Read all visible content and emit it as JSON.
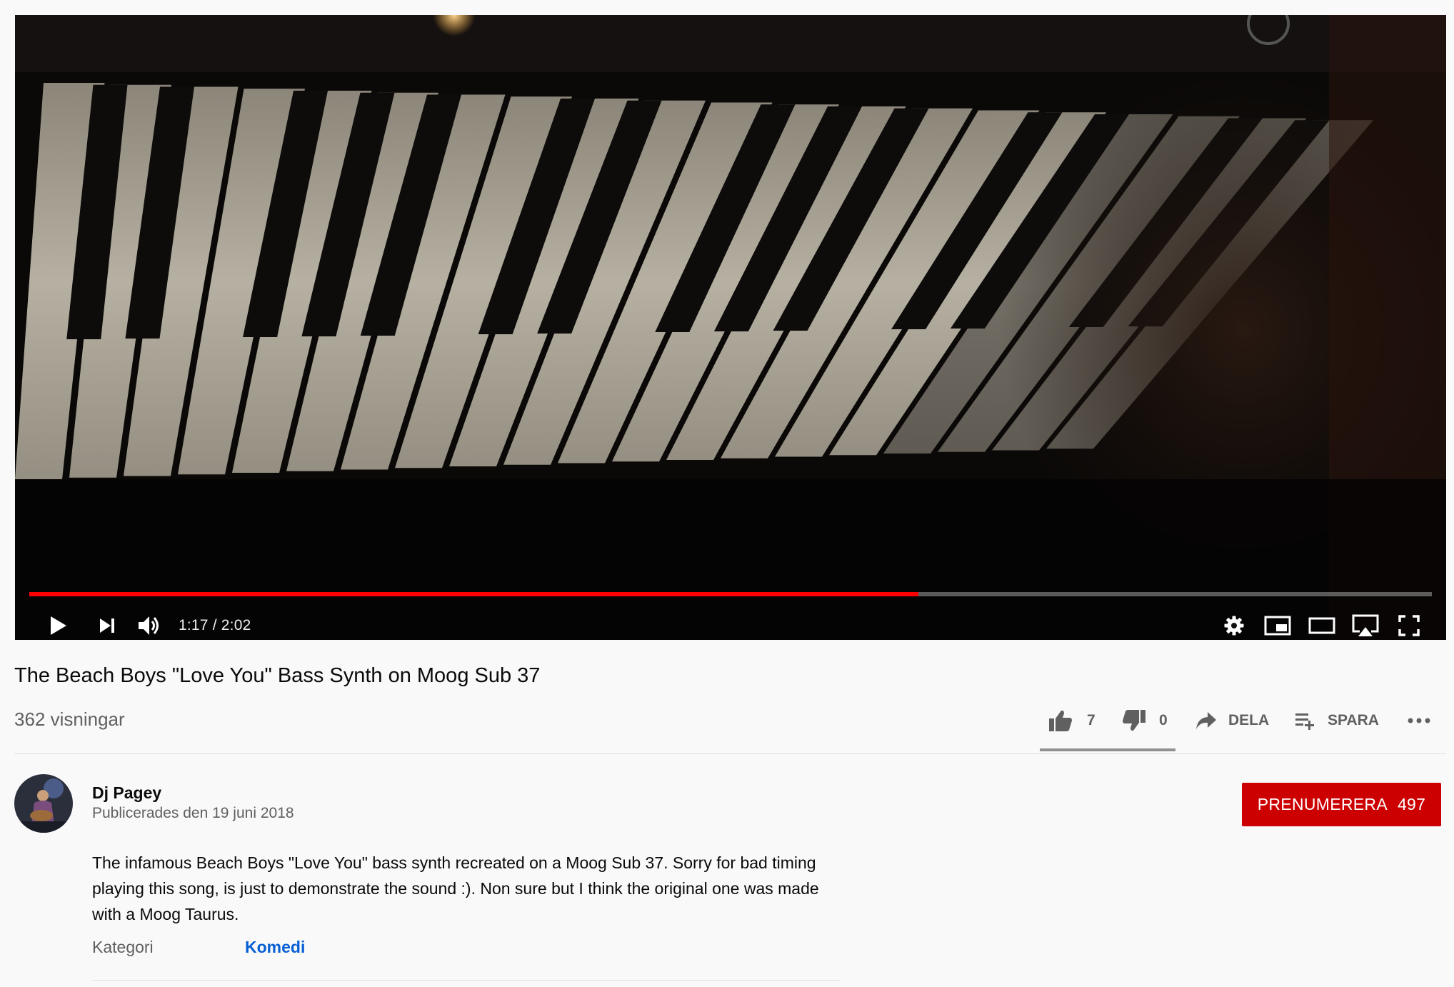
{
  "player": {
    "current_time": "1:17",
    "duration": "2:02",
    "time_display": "1:17 / 2:02",
    "progress_fraction": 0.634,
    "progress_color": "#ff0000"
  },
  "video": {
    "title": "The Beach Boys \"Love You\" Bass Synth on Moog Sub 37",
    "views": "362 visningar"
  },
  "actions": {
    "likes": "7",
    "dislikes": "0",
    "share_label": "DELA",
    "save_label": "SPARA"
  },
  "channel": {
    "name": "Dj Pagey",
    "published": "Publicerades den 19 juni 2018",
    "subscribe_label": "PRENUMERERA",
    "subscriber_count": "497",
    "subscribe_color": "#cc0000"
  },
  "description": {
    "text": "The infamous Beach Boys \"Love You\" bass synth recreated on a Moog Sub 37. Sorry for bad timing playing this song, is just to demonstrate the sound :). Non sure but I think the original one was made with a Moog Taurus.",
    "category_label": "Kategori",
    "category_value": "Komedi",
    "link_color": "#065fd4"
  },
  "icons": [
    "play-icon",
    "next-icon",
    "volume-icon",
    "settings-icon",
    "miniplayer-icon",
    "theater-icon",
    "airplay-icon",
    "fullscreen-icon",
    "like-icon",
    "dislike-icon",
    "share-icon",
    "save-playlist-icon",
    "more-icon"
  ]
}
